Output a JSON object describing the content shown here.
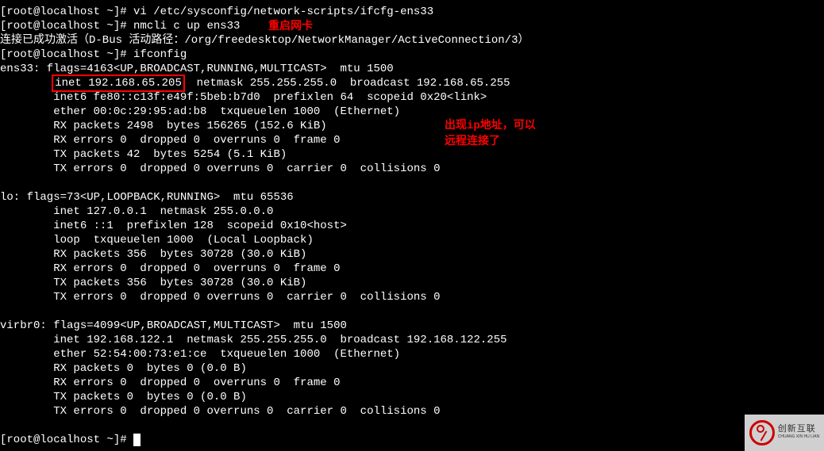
{
  "lines": {
    "l1": "[root@localhost ~]# vi /etc/sysconfig/network-scripts/ifcfg-ens33",
    "l2": "[root@localhost ~]# nmcli c up ens33",
    "l3": "连接已成功激活（D-Bus 活动路径：/org/freedesktop/NetworkManager/ActiveConnection/3）",
    "l4": "[root@localhost ~]# ifconfig",
    "l5": "ens33: flags=4163<UP,BROADCAST,RUNNING,MULTICAST>  mtu 1500",
    "l6a": "        ",
    "l6box": "inet 192.168.65.205",
    "l6b": "  netmask 255.255.255.0  broadcast 192.168.65.255",
    "l7": "        inet6 fe80::c13f:e49f:5beb:b7d0  prefixlen 64  scopeid 0x20<link>",
    "l8": "        ether 00:0c:29:95:ad:b8  txqueuelen 1000  (Ethernet)",
    "l9": "        RX packets 2498  bytes 156265 (152.6 KiB)",
    "l10": "        RX errors 0  dropped 0  overruns 0  frame 0",
    "l11": "        TX packets 42  bytes 5254 (5.1 KiB)",
    "l12": "        TX errors 0  dropped 0 overruns 0  carrier 0  collisions 0",
    "blank1": " ",
    "l13": "lo: flags=73<UP,LOOPBACK,RUNNING>  mtu 65536",
    "l14": "        inet 127.0.0.1  netmask 255.0.0.0",
    "l15": "        inet6 ::1  prefixlen 128  scopeid 0x10<host>",
    "l16": "        loop  txqueuelen 1000  (Local Loopback)",
    "l17": "        RX packets 356  bytes 30728 (30.0 KiB)",
    "l18": "        RX errors 0  dropped 0  overruns 0  frame 0",
    "l19": "        TX packets 356  bytes 30728 (30.0 KiB)",
    "l20": "        TX errors 0  dropped 0 overruns 0  carrier 0  collisions 0",
    "blank2": " ",
    "l21": "virbr0: flags=4099<UP,BROADCAST,MULTICAST>  mtu 1500",
    "l22": "        inet 192.168.122.1  netmask 255.255.255.0  broadcast 192.168.122.255",
    "l23": "        ether 52:54:00:73:e1:ce  txqueuelen 1000  (Ethernet)",
    "l24": "        RX packets 0  bytes 0 (0.0 B)",
    "l25": "        RX errors 0  dropped 0  overruns 0  frame 0",
    "l26": "        TX packets 0  bytes 0 (0.0 B)",
    "l27": "        TX errors 0  dropped 0 overruns 0  carrier 0  collisions 0",
    "blank3": " ",
    "l28": "[root@localhost ~]# "
  },
  "annotations": {
    "restart_nic": "重启网卡",
    "ip_appeared_1": "出现ip地址，可以",
    "ip_appeared_2": "远程连接了"
  },
  "logo": {
    "line1": "创新互联",
    "line2": "CHUANG XIN HU LIAN"
  }
}
